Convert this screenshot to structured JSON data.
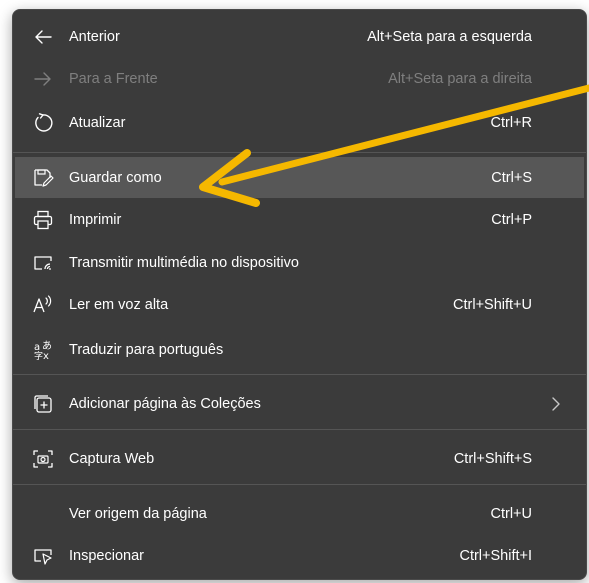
{
  "menu": {
    "items": [
      {
        "label": "Anterior",
        "shortcut": "Alt+Seta para a esquerda",
        "icon": "back-arrow-icon"
      },
      {
        "label": "Para a Frente",
        "shortcut": "Alt+Seta para a direita",
        "icon": "forward-arrow-icon",
        "disabled": true
      },
      {
        "label": "Atualizar",
        "shortcut": "Ctrl+R",
        "icon": "refresh-icon"
      },
      {
        "label": "Guardar como",
        "shortcut": "Ctrl+S",
        "icon": "save-as-icon",
        "highlighted": true
      },
      {
        "label": "Imprimir",
        "shortcut": "Ctrl+P",
        "icon": "printer-icon"
      },
      {
        "label": "Transmitir multimédia no dispositivo",
        "shortcut": "",
        "icon": "cast-icon"
      },
      {
        "label": "Ler em voz alta",
        "shortcut": "Ctrl+Shift+U",
        "icon": "read-aloud-icon"
      },
      {
        "label": "Traduzir para português",
        "shortcut": "",
        "icon": "translate-icon"
      },
      {
        "label": "Adicionar página às Coleções",
        "shortcut": "",
        "icon": "collections-icon",
        "submenu": true
      },
      {
        "label": "Captura Web",
        "shortcut": "Ctrl+Shift+S",
        "icon": "web-capture-icon"
      },
      {
        "label": "Ver origem da página",
        "shortcut": "Ctrl+U",
        "icon": ""
      },
      {
        "label": "Inspecionar",
        "shortcut": "Ctrl+Shift+I",
        "icon": "inspect-icon"
      }
    ]
  },
  "colors": {
    "menu_background": "#3b3b3b",
    "highlight": "#575757",
    "text": "#ffffff",
    "disabled_text": "#7f7f7f",
    "annotation_arrow": "#f5b800"
  }
}
